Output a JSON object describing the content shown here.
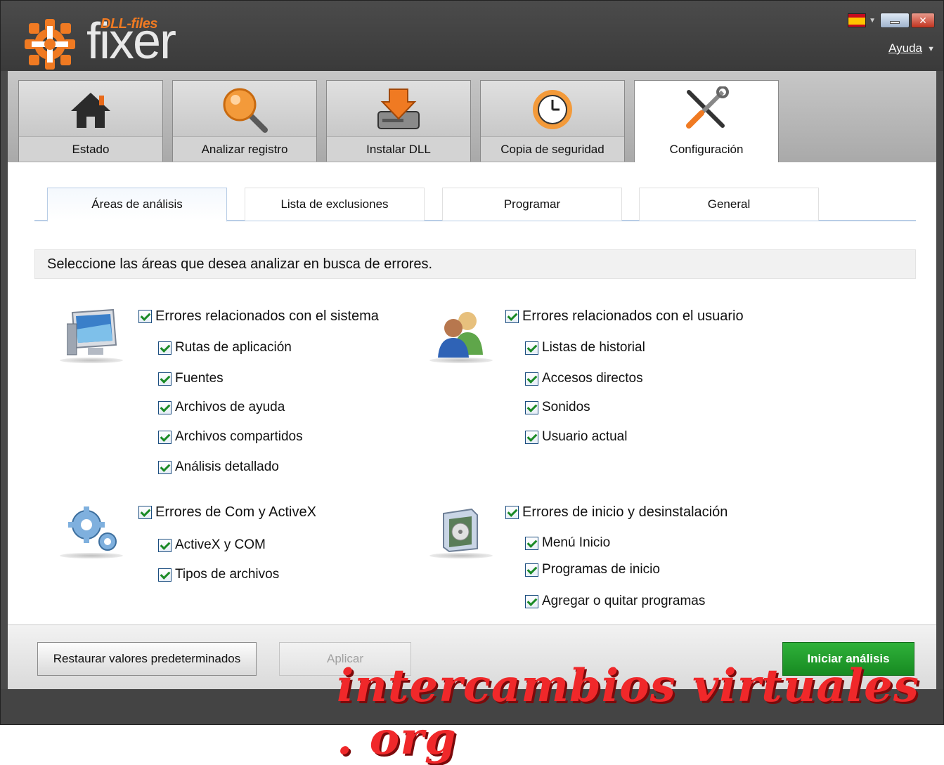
{
  "app": {
    "brand_small": "DLL-files",
    "brand_big": "fixer"
  },
  "titlebar": {
    "help_label": "Ayuda",
    "language_flag": "spain-flag"
  },
  "main_tabs": [
    {
      "label": "Estado",
      "icon": "home-icon"
    },
    {
      "label": "Analizar registro",
      "icon": "magnifier-icon"
    },
    {
      "label": "Instalar DLL",
      "icon": "download-drive-icon"
    },
    {
      "label": "Copia de seguridad",
      "icon": "clock-backup-icon"
    },
    {
      "label": "Configuración",
      "icon": "tools-icon",
      "active": true
    }
  ],
  "sub_tabs": [
    {
      "label": "Áreas de análisis",
      "active": true
    },
    {
      "label": "Lista de exclusiones"
    },
    {
      "label": "Programar"
    },
    {
      "label": "General"
    }
  ],
  "hint": "Seleccione las áreas que desea analizar en busca de errores.",
  "groups": {
    "system": {
      "label": "Errores relacionados con el sistema",
      "icon": "monitor-icon",
      "items": [
        "Rutas de aplicación",
        "Fuentes",
        "Archivos de ayuda",
        "Archivos compartidos",
        "Análisis detallado"
      ]
    },
    "user": {
      "label": "Errores relacionados con el usuario",
      "icon": "users-icon",
      "items": [
        "Listas de historial",
        "Accesos directos",
        "Sonidos",
        "Usuario actual"
      ]
    },
    "com": {
      "label": "Errores de Com y ActiveX",
      "icon": "gears-icon",
      "items": [
        "ActiveX y COM",
        "Tipos de archivos"
      ]
    },
    "startup": {
      "label": "Errores de inicio y desinstalación",
      "icon": "software-box-icon",
      "items": [
        "Menú Inicio",
        "Programas de inicio",
        "Agregar o quitar programas"
      ]
    }
  },
  "footer": {
    "restore_label": "Restaurar valores predeterminados",
    "apply_label": "Aplicar",
    "start_label": "Iniciar análisis"
  },
  "watermark": "intercambios virtuales . org",
  "colors": {
    "primary_button": "#1f9c2b",
    "accent": "#f07a22",
    "checkbox_check": "#1a8a25"
  }
}
